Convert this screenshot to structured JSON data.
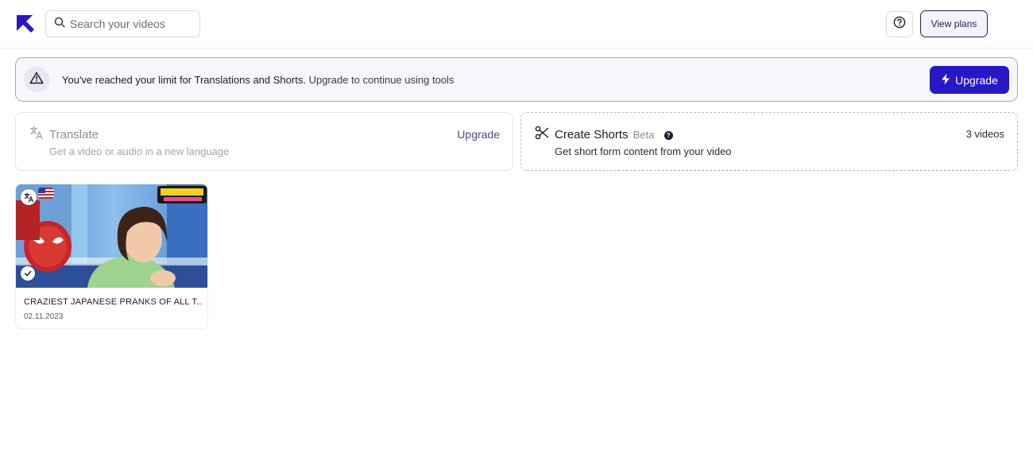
{
  "header": {
    "search_placeholder": "Search your videos",
    "view_plans_label": "View plans"
  },
  "banner": {
    "message_strong": "You've reached your limit for Translations and Shorts.",
    "message_rest": "Upgrade to continue using tools",
    "upgrade_label": "Upgrade"
  },
  "tools": {
    "translate": {
      "title": "Translate",
      "description": "Get a video or audio in a new language",
      "action_label": "Upgrade"
    },
    "shorts": {
      "title": "Create Shorts",
      "badge": "Beta",
      "description": "Get short form content from your video",
      "count_label": "3 videos"
    }
  },
  "videos": [
    {
      "title": "CRAZIEST JAPANESE PRANKS OF ALL T...",
      "date": "02.11.2023"
    }
  ],
  "colors": {
    "accent": "#2418c9",
    "plans_border": "#23235a",
    "banner_bg": "#f6f6fb"
  },
  "icons": {
    "logo": "arrow-up-left-logo",
    "search": "search-icon",
    "help": "help-circle-icon",
    "warning": "warning-triangle-icon",
    "bolt": "lightning-icon",
    "translate": "translate-icon",
    "scissors": "scissors-icon",
    "check": "check-icon"
  }
}
